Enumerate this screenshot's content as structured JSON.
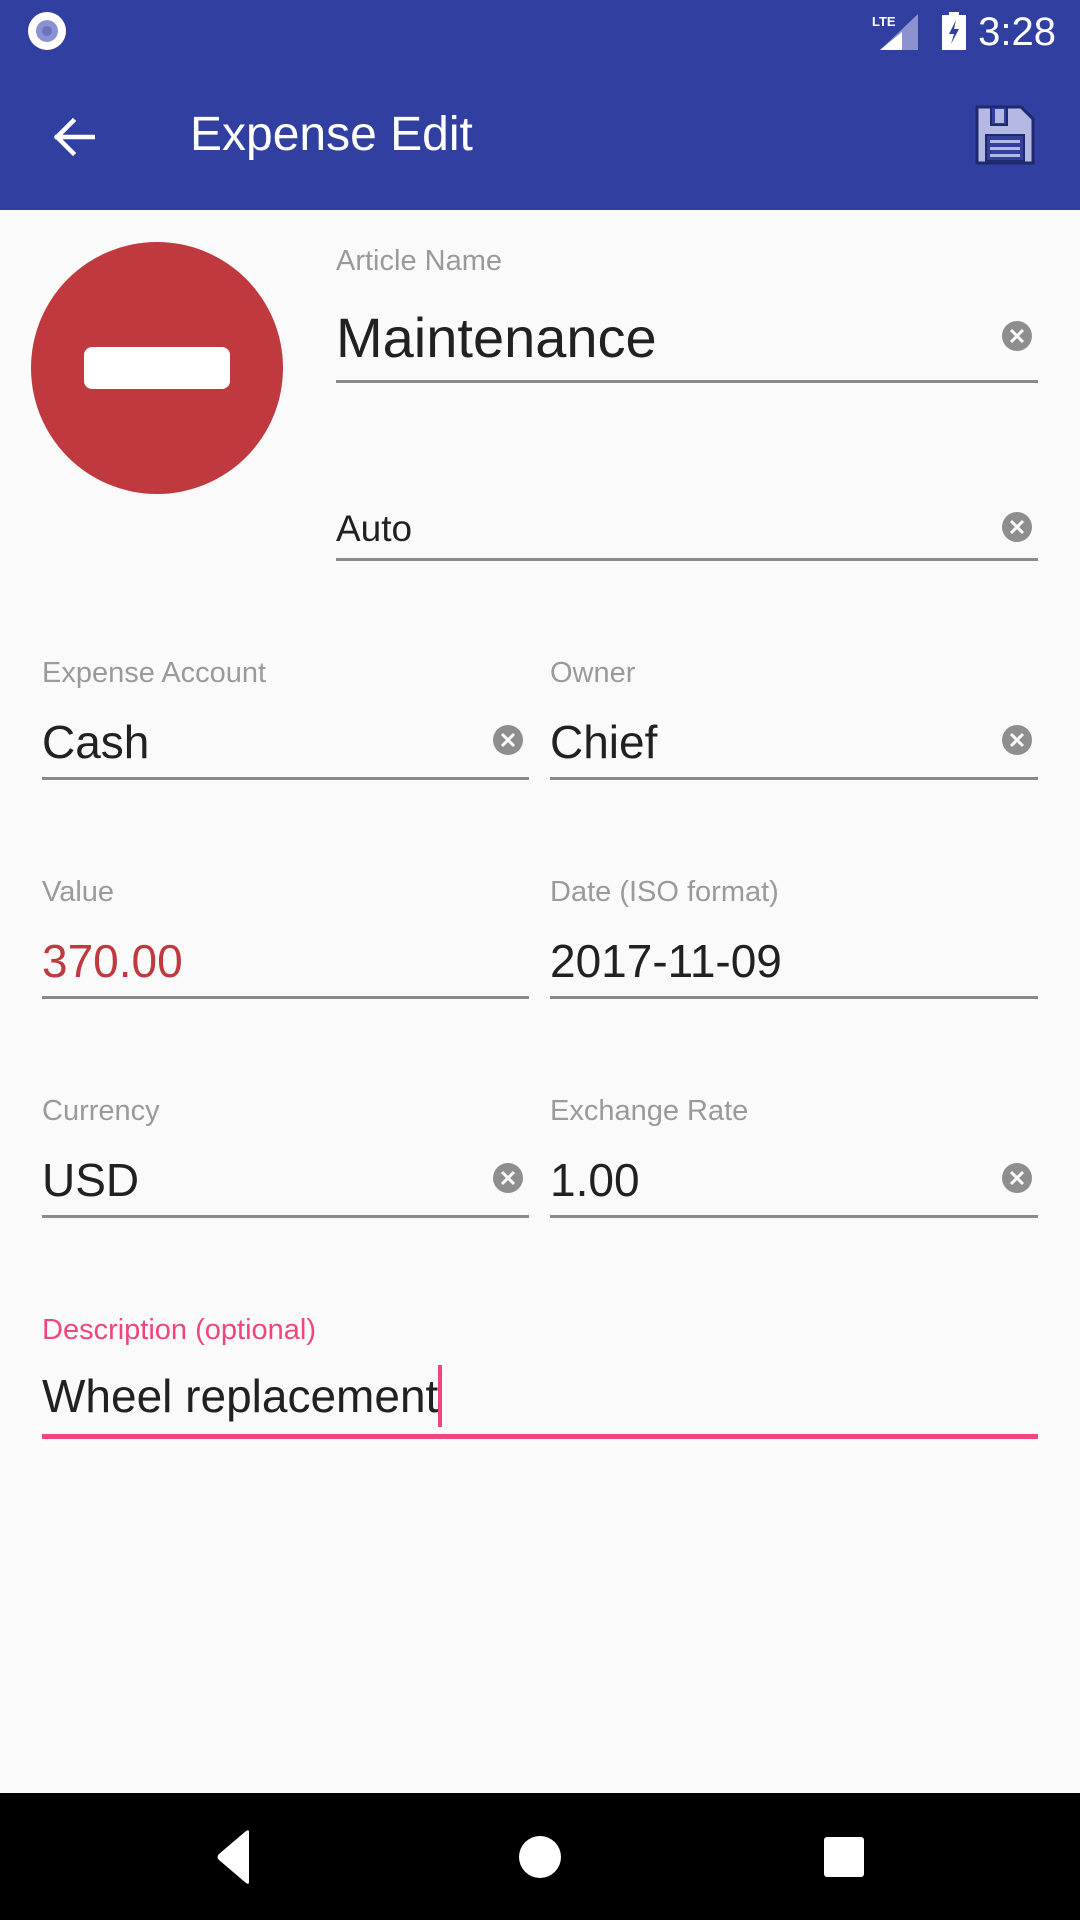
{
  "status_bar": {
    "time": "3:28",
    "network": "LTE",
    "icons": [
      "notification-dot-icon",
      "lte-signal-icon",
      "battery-charging-icon"
    ]
  },
  "app_bar": {
    "title": "Expense Edit",
    "back_icon": "arrow-back-icon",
    "save_icon": "floppy-disk-icon"
  },
  "type_badge": {
    "icon": "minus-circle-icon",
    "color": "#c0393e",
    "meaning": "expense"
  },
  "form": {
    "article_name": {
      "label": "Article Name",
      "value": "Maintenance"
    },
    "category": {
      "label": "",
      "value": "Auto"
    },
    "expense_account": {
      "label": "Expense Account",
      "value": "Cash"
    },
    "owner": {
      "label": "Owner",
      "value": "Chief"
    },
    "value": {
      "label": "Value",
      "value": "370.00",
      "color": "#c0393e"
    },
    "date": {
      "label": "Date (ISO format)",
      "value": "2017-11-09"
    },
    "currency": {
      "label": "Currency",
      "value": "USD"
    },
    "exchange_rate": {
      "label": "Exchange Rate",
      "value": "1.00"
    },
    "description": {
      "label": "Description (optional)",
      "value": "Wheel replacement",
      "focused": true,
      "accent": "#f0457f"
    }
  },
  "nav_bar": {
    "buttons": [
      "back-nav-icon",
      "home-nav-icon",
      "recents-nav-icon"
    ]
  },
  "colors": {
    "primary": "#3140a0",
    "accent": "#f0457f",
    "expense_red": "#c0393e"
  }
}
